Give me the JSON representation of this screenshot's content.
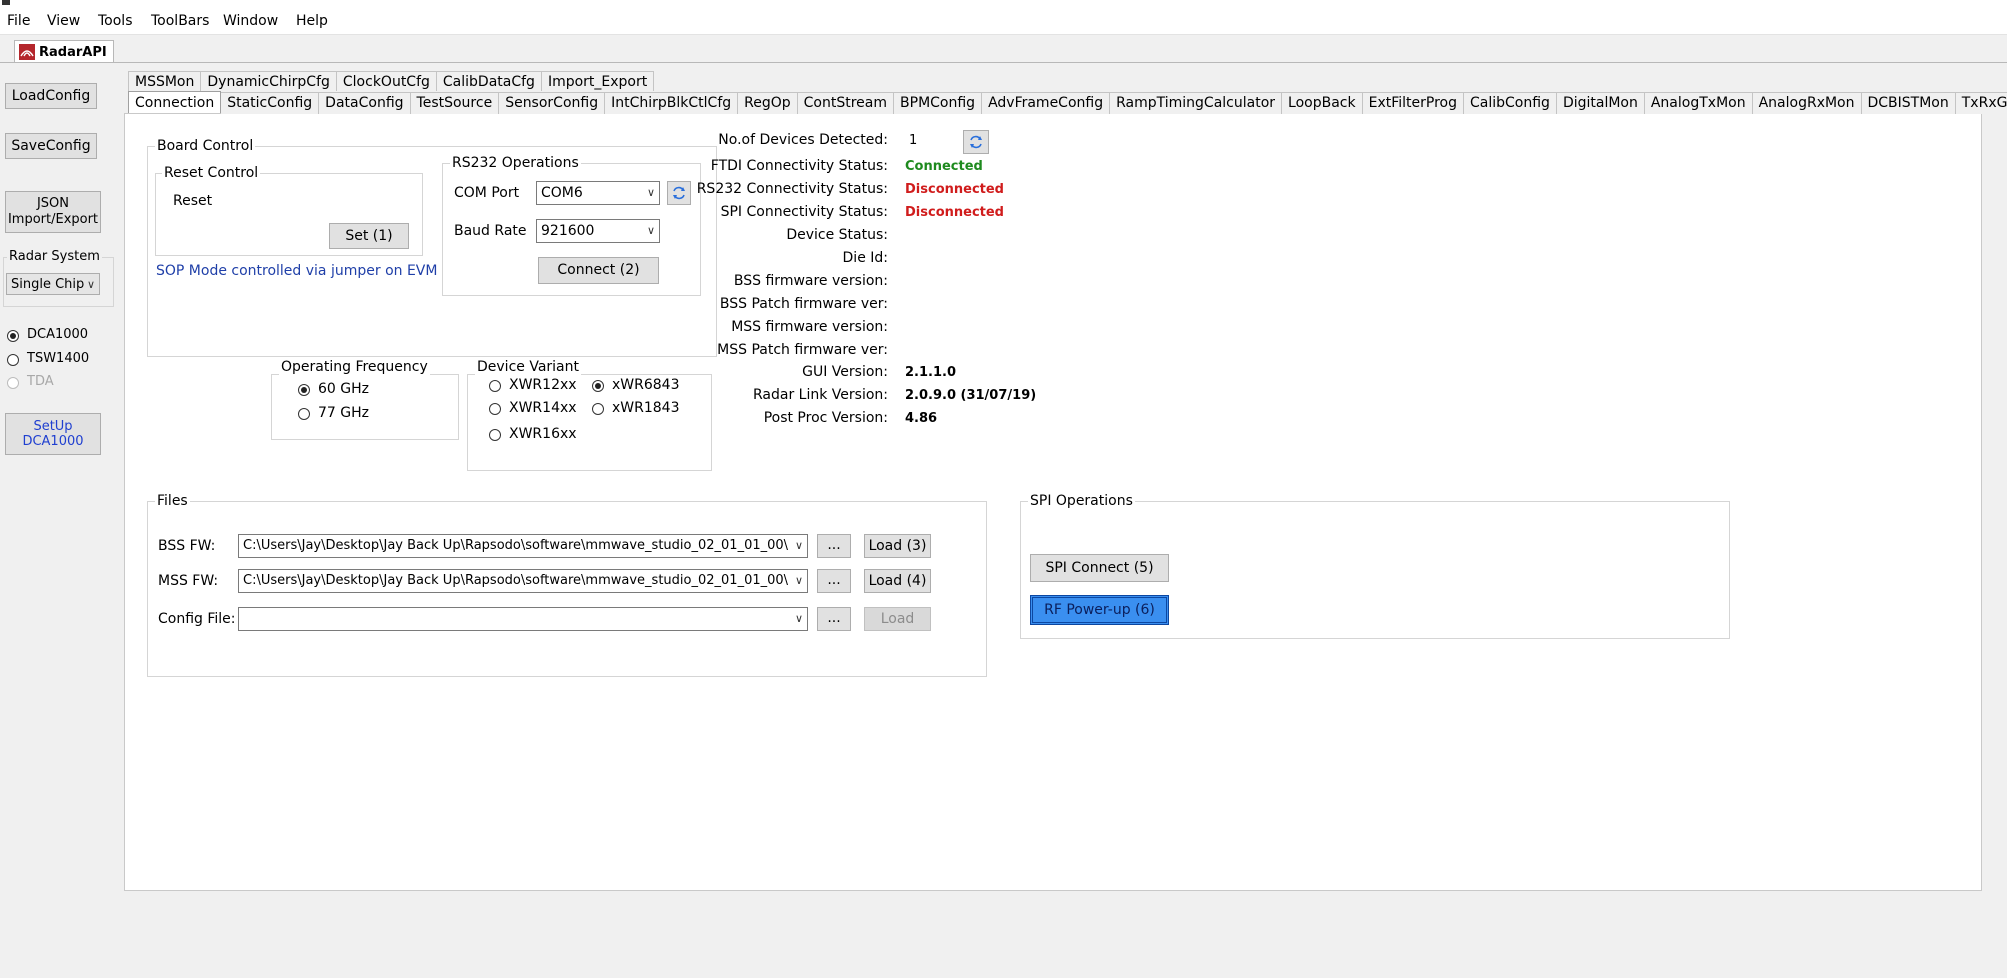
{
  "menu": [
    "File",
    "View",
    "Tools",
    "ToolBars",
    "Window",
    "Help"
  ],
  "app_tab": "RadarAPI",
  "left": {
    "load_config": "LoadConfig",
    "save_config": "SaveConfig",
    "json_line1": "JSON",
    "json_line2": "Import/Export",
    "radar_system_label": "Radar System",
    "radar_system_value": "Single Chip",
    "capture_options": [
      {
        "label": "DCA1000",
        "selected": true,
        "enabled": true
      },
      {
        "label": "TSW1400",
        "selected": false,
        "enabled": true
      },
      {
        "label": "TDA",
        "selected": false,
        "enabled": false
      }
    ],
    "setup_line1": "SetUp",
    "setup_line2": "DCA1000"
  },
  "tabs_row1": [
    "MSSMon",
    "DynamicChirpCfg",
    "ClockOutCfg",
    "CalibDataCfg",
    "Import_Export"
  ],
  "tabs_row2": [
    "Connection",
    "StaticConfig",
    "DataConfig",
    "TestSource",
    "SensorConfig",
    "IntChirpBlkCtlCfg",
    "RegOp",
    "ContStream",
    "BPMConfig",
    "AdvFrameConfig",
    "RampTimingCalculator",
    "LoopBack",
    "ExtFilterProg",
    "CalibConfig",
    "DigitalMon",
    "AnalogTxMon",
    "AnalogRxMon",
    "DCBISTMon",
    "TxRxGainTemp"
  ],
  "active_tab": "Connection",
  "board_control": {
    "title": "Board Control",
    "reset_group": "Reset Control",
    "reset_label": "Reset",
    "set_button": "Set (1)",
    "sop_note": "SOP Mode controlled via jumper on EVM",
    "rs232_group": "RS232 Operations",
    "com_port_label": "COM Port",
    "com_port_value": "COM6",
    "baud_label": "Baud Rate",
    "baud_value": "921600",
    "connect_button": "Connect (2)"
  },
  "operating_frequency": {
    "title": "Operating Frequency",
    "options": [
      {
        "label": "60 GHz",
        "selected": true
      },
      {
        "label": "77 GHz",
        "selected": false
      }
    ]
  },
  "device_variant": {
    "title": "Device Variant",
    "options": [
      {
        "label": "XWR12xx",
        "selected": false
      },
      {
        "label": "xWR6843",
        "selected": true
      },
      {
        "label": "XWR14xx",
        "selected": false
      },
      {
        "label": "xWR1843",
        "selected": false
      },
      {
        "label": "XWR16xx",
        "selected": false
      }
    ]
  },
  "status": {
    "devices_label": "No.of Devices Detected:",
    "devices_value": "1",
    "ftdi_label": "FTDI Connectivity Status:",
    "ftdi_value": "Connected",
    "rs232_label": "RS232 Connectivity Status:",
    "rs232_value": "Disconnected",
    "spi_label": "SPI Connectivity Status:",
    "spi_value": "Disconnected",
    "device_status_label": "Device Status:",
    "die_id_label": "Die Id:",
    "bss_fw_label": "BSS firmware version:",
    "bss_patch_label": "BSS Patch firmware ver:",
    "mss_fw_label": "MSS firmware version:",
    "mss_patch_label": "MSS Patch firmware ver:",
    "gui_version_label": "GUI Version:",
    "gui_version_value": "2.1.1.0",
    "radar_link_label": "Radar Link Version:",
    "radar_link_value": "2.0.9.0 (31/07/19)",
    "post_proc_label": "Post Proc Version:",
    "post_proc_value": "4.86",
    "connected_color": "#1e8a1e",
    "disconnected_color": "#d01c1c"
  },
  "files": {
    "title": "Files",
    "bss_label": "BSS FW:",
    "bss_path": "C:\\Users\\Jay\\Desktop\\Jay Back Up\\Rapsodo\\software\\mmwave_studio_02_01_01_00\\",
    "bss_load": "Load (3)",
    "mss_label": "MSS FW:",
    "mss_path": "C:\\Users\\Jay\\Desktop\\Jay Back Up\\Rapsodo\\software\\mmwave_studio_02_01_01_00\\",
    "mss_load": "Load (4)",
    "config_label": "Config File:",
    "config_path": "",
    "config_load": "Load",
    "browse": "..."
  },
  "spi_ops": {
    "title": "SPI Operations",
    "spi_connect": "SPI Connect (5)",
    "rf_powerup": "RF Power-up (6)"
  }
}
